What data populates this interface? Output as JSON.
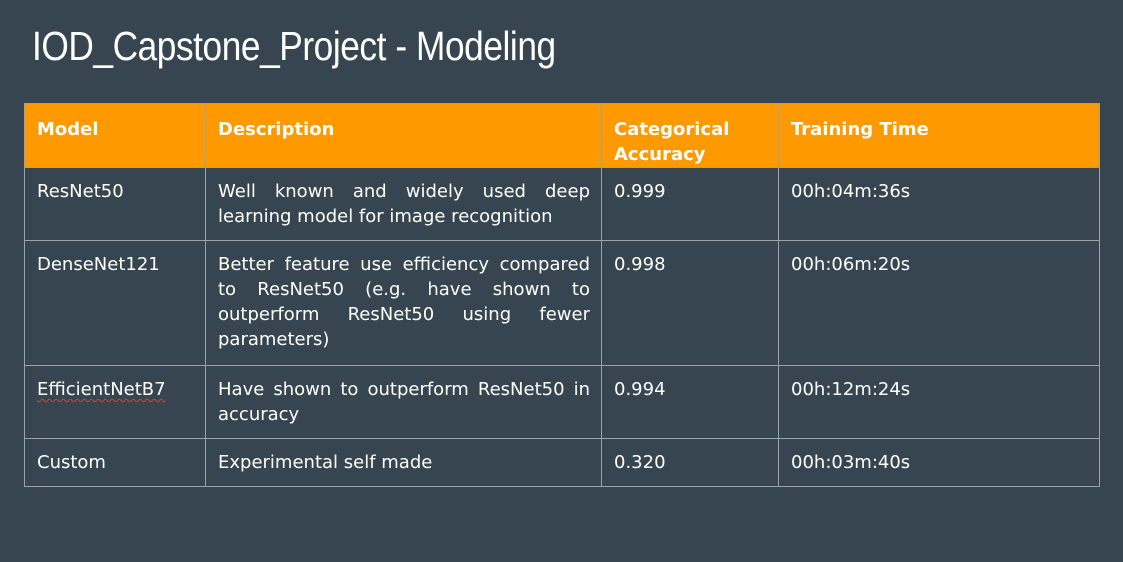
{
  "slide": {
    "title": "IOD_Capstone_Project - Modeling"
  },
  "table": {
    "headers": {
      "model": "Model",
      "description": "Description",
      "accuracy": "Categorical Accuracy",
      "time": "Training Time"
    },
    "rows": [
      {
        "model": "ResNet50",
        "description": "Well known and widely used deep learning model for image recognition",
        "accuracy": "0.999",
        "time": "00h:04m:36s"
      },
      {
        "model": "DenseNet121",
        "description": "Better feature use efficiency compared to ResNet50 (e.g. have shown to outperform ResNet50 using fewer parameters)",
        "accuracy": "0.998",
        "time": "00h:06m:20s"
      },
      {
        "model": "EfficientNetB7",
        "description": "Have shown to outperform ResNet50 in accuracy",
        "accuracy": "0.994",
        "time": "00h:12m:24s"
      },
      {
        "model": "Custom",
        "description": "Experimental self made",
        "accuracy": "0.320",
        "time": "00h:03m:40s"
      }
    ]
  },
  "colors": {
    "background": "#36454f",
    "header_fill": "#ff9900",
    "text": "#ffffff",
    "grid_line": "#9aa3a9",
    "spellcheck_underline": "#e33b3b"
  }
}
